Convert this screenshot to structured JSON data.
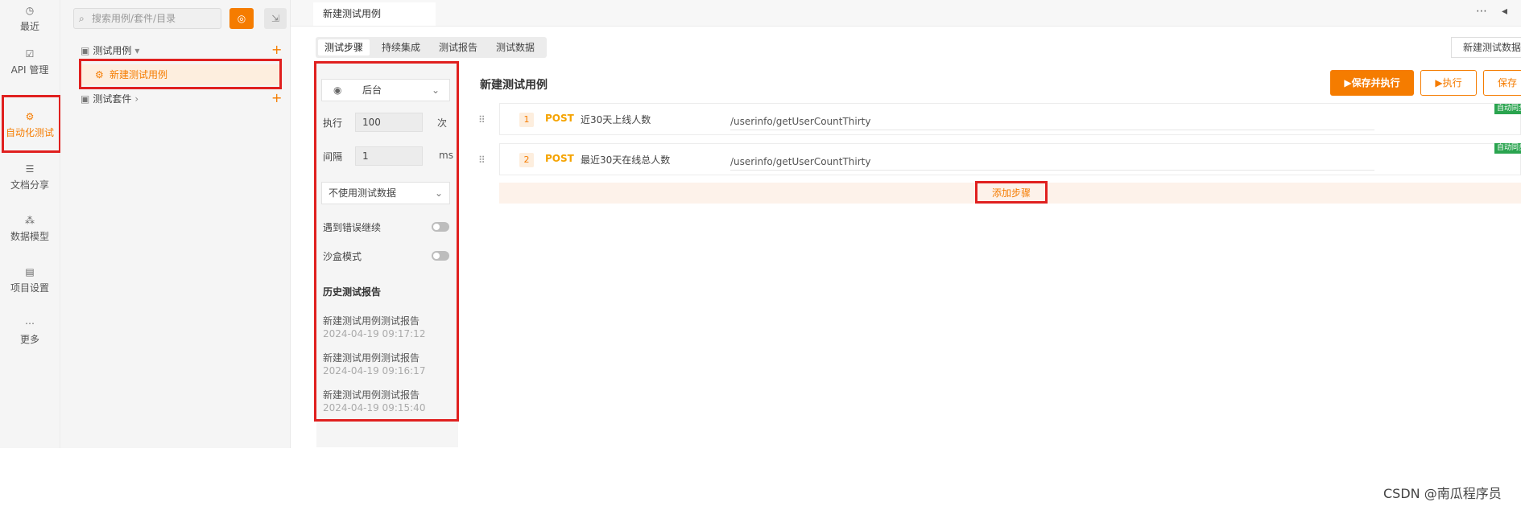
{
  "rail": {
    "items": [
      {
        "label": "最近",
        "icon": "history-icon"
      },
      {
        "label": "API 管理",
        "icon": "api-icon"
      },
      {
        "label": "自动化测试",
        "icon": "automation-icon"
      },
      {
        "label": "文档分享",
        "icon": "document-icon"
      },
      {
        "label": "数据模型",
        "icon": "data-model-icon"
      },
      {
        "label": "项目设置",
        "icon": "settings-icon"
      },
      {
        "label": "更多",
        "icon": "more-icon"
      }
    ],
    "active": "自动化测试"
  },
  "tree": {
    "search_placeholder": "搜索用例/套件/目录",
    "folders": [
      {
        "label": "测试用例"
      },
      {
        "label": "测试套件"
      }
    ],
    "selected_case": "新建测试用例"
  },
  "tabs": {
    "open_doc": "新建测试用例",
    "sub": [
      "测试步骤",
      "持续集成",
      "测试报告",
      "测试数据"
    ],
    "active_sub": "测试步骤",
    "env_button": "新建测试数据"
  },
  "config": {
    "mode": "后台",
    "repeat_label": "执行",
    "repeat_value": "100",
    "repeat_unit": "次",
    "interval_label": "间隔",
    "interval_value": "1",
    "interval_unit": "ms",
    "test_data": "不使用测试数据",
    "continue_on_error": "遇到错误继续",
    "sandbox": "沙盒模式",
    "history_title": "历史测试报告",
    "history": [
      {
        "name": "新建测试用例测试报告",
        "time": "2024-04-19 09:17:12"
      },
      {
        "name": "新建测试用例测试报告",
        "time": "2024-04-19 09:16:17"
      },
      {
        "name": "新建测试用例测试报告",
        "time": "2024-04-19 09:15:40"
      }
    ]
  },
  "main": {
    "title": "新建测试用例",
    "buttons": {
      "save_run": "▶保存并执行",
      "run": "▶执行",
      "save": "保存"
    },
    "steps": [
      {
        "index": "1",
        "method": "POST",
        "name": "近30天上线人数",
        "path": "/userinfo/getUserCountThirty",
        "badge": "自动同步"
      },
      {
        "index": "2",
        "method": "POST",
        "name": "最近30天在线总人数",
        "path": "/userinfo/getUserCountThirty",
        "badge": "自动同步"
      }
    ],
    "add_step": "添加步骤"
  },
  "watermark": "CSDN @南瓜程序员",
  "colors": {
    "accent": "#f57c00",
    "highlight_box": "#e0201f",
    "badge_green": "#2aa44f"
  }
}
